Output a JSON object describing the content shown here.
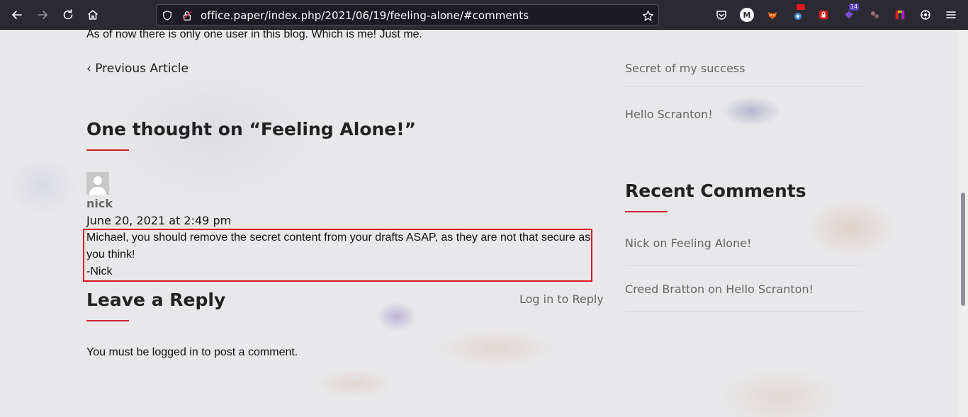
{
  "browser": {
    "url": "office.paper/index.php/2021/06/19/feeling-alone/#comments",
    "extension_badges": {
      "notifications": "14"
    },
    "icons": {
      "back": "arrow-left-icon",
      "forward": "arrow-right-icon",
      "reload": "reload-icon",
      "home": "home-icon",
      "shield": "shield-icon",
      "lock": "lock-icon",
      "bookmark": "star-icon",
      "menu": "hamburger-menu-icon"
    }
  },
  "article": {
    "intro_text": "As of now there is only one user in this blog. Which is me! Just me.",
    "prev_article_label": "Previous Article"
  },
  "comments": {
    "heading_prefix": "One thought on “",
    "heading_title": "Feeling Alone!",
    "heading_suffix": "”",
    "items": [
      {
        "author": "nick",
        "date": "June 20, 2021 at 2:49 pm",
        "line1": "Michael, you should remove the secret content from your drafts ASAP, as they are not that secure as",
        "line2": "you think!",
        "line3": "-Nick"
      }
    ]
  },
  "reply": {
    "heading": "Leave a Reply",
    "login_link": "Log in to Reply",
    "notice": "You must be logged in to post a comment."
  },
  "sidebar": {
    "recent_posts": [
      "Secret of my success",
      "Hello Scranton!"
    ],
    "recent_comments_heading": "Recent Comments",
    "recent_comments": [
      {
        "author": "Nick",
        "connector": " on ",
        "post": "Feeling Alone!"
      },
      {
        "author": "Creed Bratton",
        "connector": " on ",
        "post": "Hello Scranton!"
      }
    ]
  },
  "colors": {
    "accent_red": "#d0242a",
    "highlight_box": "#e0181f",
    "toolbar_bg": "#2b2a33"
  }
}
